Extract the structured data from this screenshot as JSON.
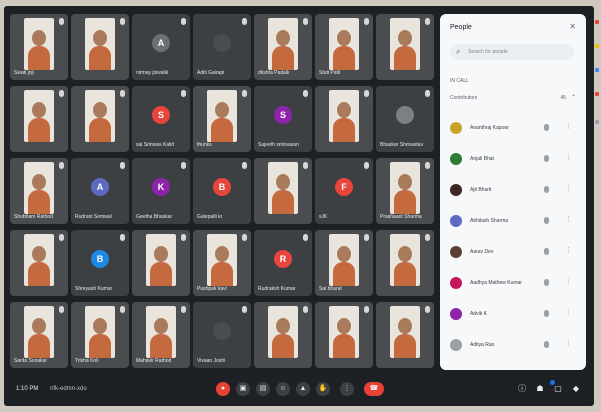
{
  "tiles": [
    {
      "type": "video",
      "name": "Swati joji"
    },
    {
      "type": "video",
      "name": ""
    },
    {
      "type": "avatar",
      "name": "nirmay jiswalik",
      "initial": "A",
      "color": "#6d6f72"
    },
    {
      "type": "avatar",
      "name": "Aditi Gairapi",
      "initial": "",
      "color": "#4a4d50"
    },
    {
      "type": "video",
      "name": "dkshta Padalk"
    },
    {
      "type": "video",
      "name": "Stuti Patil"
    },
    {
      "type": "video",
      "name": ""
    },
    {
      "type": "video",
      "name": ""
    },
    {
      "type": "video",
      "name": ""
    },
    {
      "type": "avatar",
      "name": "sai Srinivas Kalid",
      "initial": "S",
      "color": "#e8453c"
    },
    {
      "type": "video",
      "name": "thunks"
    },
    {
      "type": "avatar",
      "name": "Sujeeth srinivasan",
      "initial": "S",
      "color": "#8e24aa"
    },
    {
      "type": "video",
      "name": ""
    },
    {
      "type": "avatar",
      "name": "Bhaskar Shrivastav",
      "initial": "",
      "color": "#7d8084"
    },
    {
      "type": "video",
      "name": "Shubham Rathod"
    },
    {
      "type": "avatar",
      "name": "Rudrani Semwal",
      "initial": "A",
      "color": "#5c6bc0"
    },
    {
      "type": "avatar",
      "name": "Geetha Bhaskar",
      "initial": "K",
      "color": "#8e24aa"
    },
    {
      "type": "avatar",
      "name": "Gatepalli kr",
      "initial": "B",
      "color": "#e8453c"
    },
    {
      "type": "video",
      "name": ""
    },
    {
      "type": "avatar",
      "name": "sJK",
      "initial": "F",
      "color": "#e8453c"
    },
    {
      "type": "video",
      "name": "Prashaant Sharma"
    },
    {
      "type": "video",
      "name": ""
    },
    {
      "type": "avatar",
      "name": "Shreyash Kumar",
      "initial": "B",
      "color": "#1e88e5"
    },
    {
      "type": "video",
      "name": ""
    },
    {
      "type": "video",
      "name": "Pushpak kavi"
    },
    {
      "type": "avatar",
      "name": "Rudraksh Kumar",
      "initial": "R",
      "color": "#e8453c"
    },
    {
      "type": "video",
      "name": "Sai bharat"
    },
    {
      "type": "video",
      "name": ""
    },
    {
      "type": "video",
      "name": "Sarita Sonakar"
    },
    {
      "type": "video",
      "name": "Trisha Koli"
    },
    {
      "type": "video",
      "name": "Mahavir Rathod"
    },
    {
      "type": "avatar",
      "name": "Vivaan Joshi",
      "initial": "",
      "color": "#4a4d50"
    },
    {
      "type": "video",
      "name": ""
    },
    {
      "type": "video",
      "name": ""
    },
    {
      "type": "video",
      "name": ""
    }
  ],
  "panel": {
    "title": "People",
    "close": "✕",
    "search_placeholder": "Search for people",
    "section_label": "IN CALL",
    "group_label": "Contributors",
    "group_count": "45",
    "chevron": "⌃",
    "participants": [
      {
        "name": "Ananthraj Kapoor",
        "color": "#c9a227"
      },
      {
        "name": "Anjali Bhat",
        "color": "#2e7d32"
      },
      {
        "name": "Ajit Bharti",
        "color": "#3e2723"
      },
      {
        "name": "Abhilash Sharma",
        "color": "#5c6bc0"
      },
      {
        "name": "Aarav Dev",
        "color": "#5d4037"
      },
      {
        "name": "Aadhya Mathew Kumar",
        "color": "#c2185b"
      },
      {
        "name": "Advik K",
        "color": "#8e24aa"
      },
      {
        "name": "Aditya Rao",
        "color": "#9aa0a6"
      }
    ]
  },
  "bottom": {
    "time": "1:10 PM",
    "code": "nfk-edmn-xdo"
  }
}
